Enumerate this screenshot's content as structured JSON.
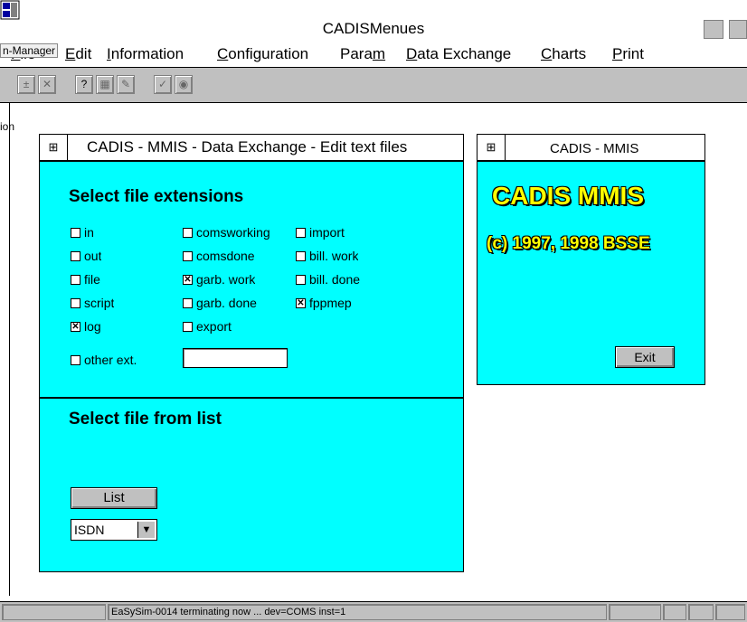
{
  "app": {
    "title": "CADISMenues"
  },
  "overlay": {
    "manager": "n-Manager",
    "side": "ion"
  },
  "menu": {
    "items": [
      {
        "pre": "",
        "u": "F",
        "post": "ile"
      },
      {
        "pre": "",
        "u": "E",
        "post": "dit"
      },
      {
        "pre": "",
        "u": "I",
        "post": "nformation"
      },
      {
        "pre": "",
        "u": "C",
        "post": "onfiguration"
      },
      {
        "pre": "Para",
        "u": "m",
        "post": ""
      },
      {
        "pre": "",
        "u": "D",
        "post": "ata Exchange"
      },
      {
        "pre": "",
        "u": "C",
        "post": "harts"
      },
      {
        "pre": "",
        "u": "P",
        "post": "rint"
      }
    ]
  },
  "toolbar": {
    "icons": [
      "plus-icon",
      "close-icon",
      "info-icon",
      "doc-icon",
      "edit-icon",
      "check-icon",
      "disk-icon"
    ]
  },
  "win1": {
    "title": "CADIS - MMIS - Data Exchange - Edit text files",
    "sysmenu": "⊞",
    "ext_heading": "Select file extensions",
    "extensions": [
      {
        "label": "in",
        "checked": false
      },
      {
        "label": "out",
        "checked": false
      },
      {
        "label": "file",
        "checked": false
      },
      {
        "label": "script",
        "checked": false
      },
      {
        "label": "log",
        "checked": true
      },
      {
        "label": "comsworking",
        "checked": false
      },
      {
        "label": "comsdone",
        "checked": false
      },
      {
        "label": "garb. work",
        "checked": true
      },
      {
        "label": "garb. done",
        "checked": false
      },
      {
        "label": "export",
        "checked": false
      },
      {
        "label": "import",
        "checked": false
      },
      {
        "label": "bill. work",
        "checked": false
      },
      {
        "label": "bill. done",
        "checked": false
      },
      {
        "label": "fppmep",
        "checked": true
      }
    ],
    "other_ext_label": "other ext.",
    "other_ext_value": "",
    "list_heading": "Select file from list",
    "list_button": "List",
    "select_value": "ISDN"
  },
  "win2": {
    "title": "CADIS - MMIS",
    "sysmenu": "⊞",
    "brand": "CADIS MMIS",
    "copyright": "(c) 1997, 1998 BSSE",
    "exit_button": "Exit"
  },
  "status": {
    "text": "EaSySim-0014 terminating now ... dev=COMS inst=1"
  },
  "colors": {
    "pane": "#00ffff",
    "brand": "#ffff00",
    "chrome": "#c0c0c0"
  }
}
